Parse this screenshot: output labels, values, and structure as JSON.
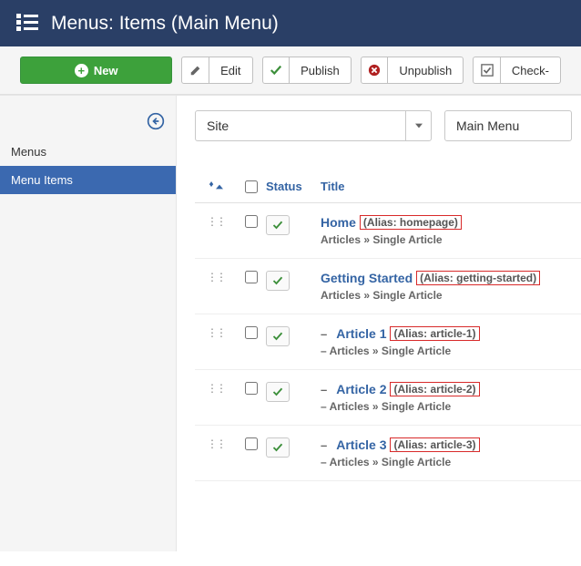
{
  "header": {
    "title": "Menus: Items (Main Menu)"
  },
  "toolbar": {
    "new_label": "New",
    "edit_label": "Edit",
    "publish_label": "Publish",
    "unpublish_label": "Unpublish",
    "checkin_label": "Check-"
  },
  "sidebar": {
    "items": [
      {
        "label": "Menus"
      },
      {
        "label": "Menu Items"
      }
    ]
  },
  "filters": {
    "site_label": "Site",
    "menu_label": "Main Menu"
  },
  "table": {
    "columns": {
      "status": "Status",
      "title": "Title"
    },
    "rows": [
      {
        "indent": 0,
        "title": "Home",
        "alias": "(Alias: homepage)",
        "sub": "Articles » Single Article"
      },
      {
        "indent": 0,
        "title": "Getting Started",
        "alias": "(Alias: getting-started)",
        "sub": "Articles » Single Article"
      },
      {
        "indent": 1,
        "title": "Article 1",
        "alias": "(Alias: article-1)",
        "sub": "Articles » Single Article"
      },
      {
        "indent": 1,
        "title": "Article 2",
        "alias": "(Alias: article-2)",
        "sub": "Articles » Single Article"
      },
      {
        "indent": 1,
        "title": "Article 3",
        "alias": "(Alias: article-3)",
        "sub": "Articles » Single Article"
      }
    ]
  }
}
